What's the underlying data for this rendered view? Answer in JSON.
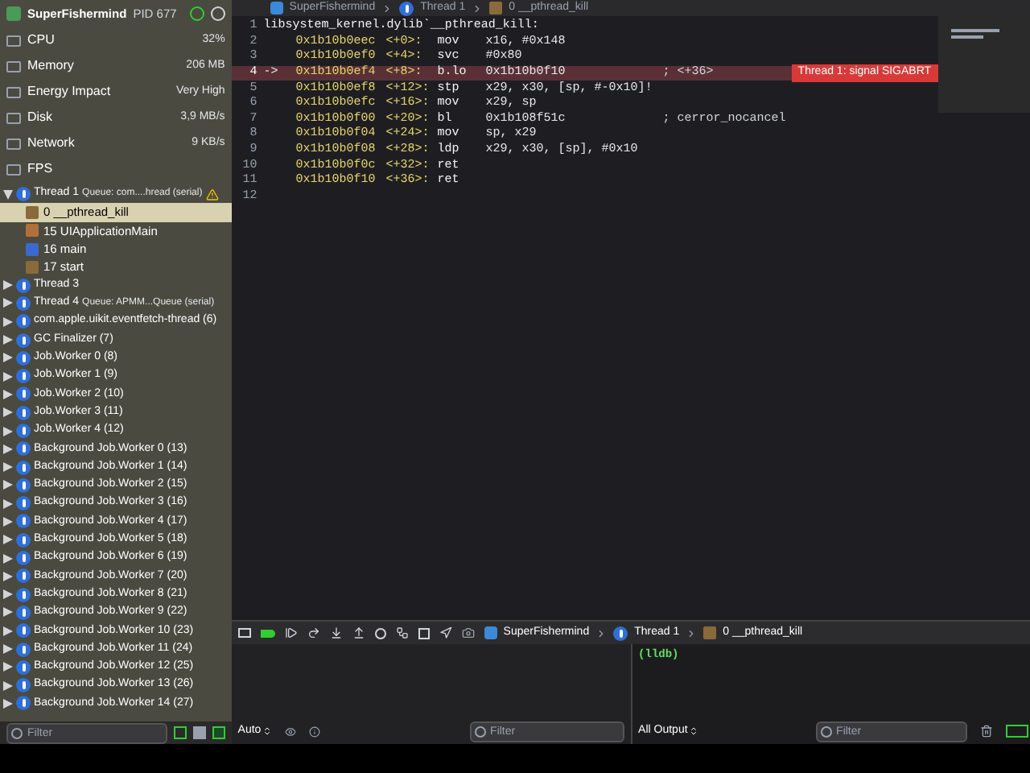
{
  "process": {
    "name": "SuperFishermind",
    "pid": "PID 677"
  },
  "gauges": [
    {
      "label": "CPU",
      "value": "32%"
    },
    {
      "label": "Memory",
      "value": "206 MB"
    },
    {
      "label": "Energy Impact",
      "value": "Very High"
    },
    {
      "label": "Disk",
      "value": "3,9 MB/s"
    },
    {
      "label": "Network",
      "value": "9 KB/s"
    },
    {
      "label": "FPS"
    }
  ],
  "threads": [
    {
      "name": "Thread 1",
      "queue": "Queue: com....hread (serial)",
      "warning": true,
      "expanded": true,
      "children": [
        {
          "label": "0 __pthread_kill",
          "kind": "system",
          "selected": true
        },
        {
          "label": "15 UIApplicationMain",
          "kind": "framework",
          "selected": false
        },
        {
          "label": "16 main",
          "kind": "user",
          "selected": false
        },
        {
          "label": "17 start",
          "kind": "system",
          "selected": false
        }
      ]
    },
    {
      "name": "Thread 3",
      "expanded": false
    },
    {
      "name": "Thread 4",
      "queue": "Queue: APMM...Queue (serial)",
      "expanded": false
    },
    {
      "name": "com.apple.uikit.eventfetch-thread (6)",
      "expanded": false
    },
    {
      "name": "GC Finalizer (7)",
      "expanded": false
    },
    {
      "name": "Job.Worker 0 (8)",
      "expanded": false
    },
    {
      "name": "Job.Worker 1 (9)",
      "expanded": false
    },
    {
      "name": "Job.Worker 2 (10)",
      "expanded": false
    },
    {
      "name": "Job.Worker 3 (11)",
      "expanded": false
    },
    {
      "name": "Job.Worker 4 (12)",
      "expanded": false
    },
    {
      "name": "Background Job.Worker 0 (13)",
      "expanded": false
    },
    {
      "name": "Background Job.Worker 1 (14)",
      "expanded": false
    },
    {
      "name": "Background Job.Worker 2 (15)",
      "expanded": false
    },
    {
      "name": "Background Job.Worker 3 (16)",
      "expanded": false
    },
    {
      "name": "Background Job.Worker 4 (17)",
      "expanded": false
    },
    {
      "name": "Background Job.Worker 5 (18)",
      "expanded": false
    },
    {
      "name": "Background Job.Worker 6 (19)",
      "expanded": false
    },
    {
      "name": "Background Job.Worker 7 (20)",
      "expanded": false
    },
    {
      "name": "Background Job.Worker 8 (21)",
      "expanded": false
    },
    {
      "name": "Background Job.Worker 9 (22)",
      "expanded": false
    },
    {
      "name": "Background Job.Worker 10 (23)",
      "expanded": false
    },
    {
      "name": "Background Job.Worker 11 (24)",
      "expanded": false
    },
    {
      "name": "Background Job.Worker 12 (25)",
      "expanded": false
    },
    {
      "name": "Background Job.Worker 13 (26)",
      "expanded": false
    },
    {
      "name": "Background Job.Worker 14 (27)",
      "expanded": false
    }
  ],
  "sidebar_filter": {
    "placeholder": "Filter"
  },
  "editor": {
    "breadcrumb": [
      "SuperFishermind",
      "Thread 1",
      "0 __pthread_kill"
    ],
    "lines": [
      {
        "number": "1",
        "kind": "label",
        "text": "libsystem_kernel.dylib`__pthread_kill:",
        "current": false
      },
      {
        "number": "2",
        "kind": "instruction",
        "address": "0x1b10b0eec",
        "offset": "<+0>:",
        "mnemonic": "mov",
        "operands": "x16, #0x148",
        "current": false
      },
      {
        "number": "3",
        "kind": "instruction",
        "address": "0x1b10b0ef0",
        "offset": "<+4>:",
        "mnemonic": "svc",
        "operands": "#0x80",
        "current": false
      },
      {
        "number": "4",
        "kind": "instruction",
        "marker": "->",
        "address": "0x1b10b0ef4",
        "offset": "<+8>:",
        "mnemonic": "b.lo",
        "operands": "0x1b10b0f10",
        "comment": "; <+36>",
        "annotation": "Thread 1: signal SIGABRT",
        "current": true
      },
      {
        "number": "5",
        "kind": "instruction",
        "address": "0x1b10b0ef8",
        "offset": "<+12>:",
        "mnemonic": "stp",
        "operands": "x29, x30, [sp, #-0x10]!",
        "current": false
      },
      {
        "number": "6",
        "kind": "instruction",
        "address": "0x1b10b0efc",
        "offset": "<+16>:",
        "mnemonic": "mov",
        "operands": "x29, sp",
        "current": false
      },
      {
        "number": "7",
        "kind": "instruction",
        "address": "0x1b10b0f00",
        "offset": "<+20>:",
        "mnemonic": "bl",
        "operands": "0x1b108f51c",
        "comment": "; cerror_nocancel",
        "current": false
      },
      {
        "number": "8",
        "kind": "instruction",
        "address": "0x1b10b0f04",
        "offset": "<+24>:",
        "mnemonic": "mov",
        "operands": "sp, x29",
        "current": false
      },
      {
        "number": "9",
        "kind": "instruction",
        "address": "0x1b10b0f08",
        "offset": "<+28>:",
        "mnemonic": "ldp",
        "operands": "x29, x30, [sp], #0x10",
        "current": false
      },
      {
        "number": "10",
        "kind": "instruction",
        "address": "0x1b10b0f0c",
        "offset": "<+32>:",
        "mnemonic": "ret",
        "current": false
      },
      {
        "number": "11",
        "kind": "instruction",
        "address": "0x1b10b0f10",
        "offset": "<+36>:",
        "mnemonic": "ret",
        "current": false
      },
      {
        "number": "12",
        "kind": "empty",
        "current": false
      }
    ]
  },
  "debug_bar": {
    "breadcrumb": [
      "SuperFishermind",
      "Thread 1",
      "0 __pthread_kill"
    ]
  },
  "variables": {
    "scope": "Auto",
    "filter_placeholder": "Filter"
  },
  "console": {
    "prompt": "(lldb)",
    "output_mode": "All Output",
    "filter_placeholder": "Filter"
  }
}
